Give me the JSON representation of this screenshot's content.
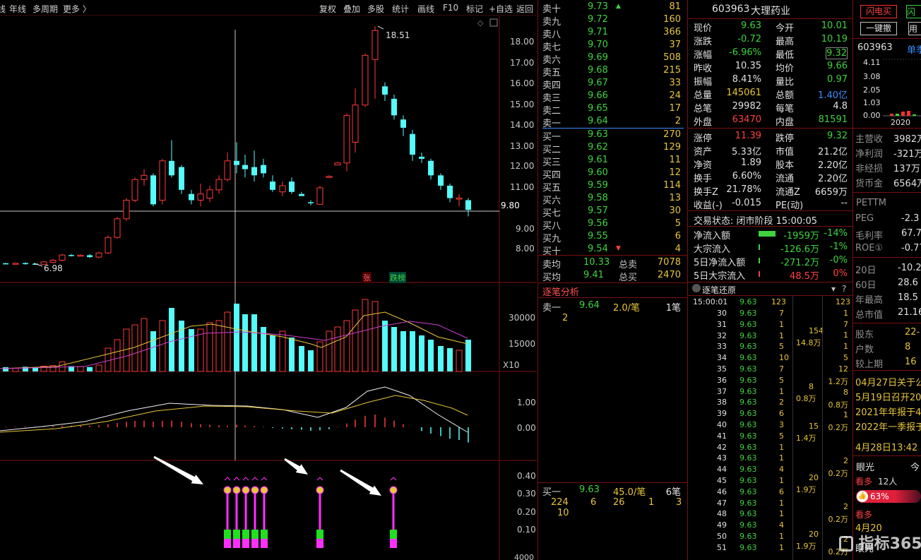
{
  "toolbar": {
    "left": [
      "年线",
      "多周期",
      "更多 〉"
    ],
    "right": [
      "复权",
      "叠加",
      "多股",
      "统计",
      "画线",
      "F10",
      "标记",
      "+自选",
      "返回"
    ]
  },
  "chart": {
    "price_ticks": [
      "18.00",
      "17.00",
      "16.00",
      "15.00",
      "14.00",
      "13.00",
      "12.00",
      "11.00",
      "9.80",
      "9.00",
      "8.00"
    ],
    "high_label": "18.51",
    "low_label": "6.98",
    "tag_zhang": "张",
    "tag_dieban": "跌榜",
    "vol_ticks": [
      "30000",
      "15000"
    ],
    "vol_unit": "X10",
    "macd_ticks": [
      "1.00",
      "0.00"
    ],
    "ind_ticks": [
      "0.40",
      "0.30",
      "0.20",
      "0.10"
    ],
    "bottom_tick": "4000"
  },
  "orderbook": {
    "sells": [
      {
        "label": "卖十",
        "price": "9.73",
        "vol": "81"
      },
      {
        "label": "卖九",
        "price": "9.72",
        "vol": "160"
      },
      {
        "label": "卖八",
        "price": "9.71",
        "vol": "366"
      },
      {
        "label": "卖七",
        "price": "9.70",
        "vol": "37"
      },
      {
        "label": "卖六",
        "price": "9.69",
        "vol": "508"
      },
      {
        "label": "卖五",
        "price": "9.68",
        "vol": "215"
      },
      {
        "label": "卖四",
        "price": "9.67",
        "vol": "33"
      },
      {
        "label": "卖三",
        "price": "9.66",
        "vol": "24"
      },
      {
        "label": "卖二",
        "price": "9.65",
        "vol": "17"
      },
      {
        "label": "卖一",
        "price": "9.64",
        "vol": "2"
      }
    ],
    "buys": [
      {
        "label": "买一",
        "price": "9.63",
        "vol": "270"
      },
      {
        "label": "买二",
        "price": "9.62",
        "vol": "129"
      },
      {
        "label": "买三",
        "price": "9.61",
        "vol": "11"
      },
      {
        "label": "买四",
        "price": "9.60",
        "vol": "12"
      },
      {
        "label": "买五",
        "price": "9.59",
        "vol": "114"
      },
      {
        "label": "买六",
        "price": "9.58",
        "vol": "13"
      },
      {
        "label": "买七",
        "price": "9.57",
        "vol": "30"
      },
      {
        "label": "买八",
        "price": "9.56",
        "vol": "5"
      },
      {
        "label": "买九",
        "price": "9.55",
        "vol": "6"
      },
      {
        "label": "买十",
        "price": "9.54",
        "vol": "4"
      }
    ],
    "avg_sell_label": "卖均",
    "avg_sell": "10.33",
    "total_sell_label": "总卖",
    "total_sell": "7078",
    "avg_buy_label": "买均",
    "avg_buy": "9.41",
    "total_buy_label": "总买",
    "total_buy": "2470"
  },
  "tick_analysis": {
    "title": "逐笔分析",
    "sell1": {
      "label": "卖一",
      "price": "9.64",
      "per": "2.0/笔",
      "count": "1笔",
      "list": "2"
    },
    "buy1": {
      "label": "买一",
      "price": "9.63",
      "per": "45.0/笔",
      "count": "6笔",
      "list": [
        "224",
        "6",
        "26",
        "1",
        "3",
        "10"
      ]
    }
  },
  "stock": {
    "code": "603963",
    "name": "大理药业",
    "rows": [
      {
        "l1": "现价",
        "v1": "9.63",
        "c1": "green",
        "l2": "今开",
        "v2": "10.01",
        "c2": "green"
      },
      {
        "l1": "涨跌",
        "v1": "-0.72",
        "c1": "green",
        "l2": "最高",
        "v2": "10.19",
        "c2": "green"
      },
      {
        "l1": "涨幅",
        "v1": "-6.96%",
        "c1": "green",
        "l2": "最低",
        "v2": "9.32",
        "c2": "green"
      },
      {
        "l1": "昨收",
        "v1": "10.35",
        "c1": "white",
        "l2": "均价",
        "v2": "9.66",
        "c2": "green"
      },
      {
        "l1": "振幅",
        "v1": "8.41%",
        "c1": "white",
        "l2": "量比",
        "v2": "0.97",
        "c2": "green"
      },
      {
        "l1": "总量",
        "v1": "145061",
        "c1": "yellow",
        "l2": "总额",
        "v2": "1.40亿",
        "c2": "blue"
      },
      {
        "l1": "总笔",
        "v1": "29982",
        "c1": "white",
        "l2": "每笔",
        "v2": "4.8",
        "c2": "white"
      },
      {
        "l1": "外盘",
        "v1": "63470",
        "c1": "red",
        "l2": "内盘",
        "v2": "81591",
        "c2": "green"
      },
      {
        "l1": "涨停",
        "v1": "11.39",
        "c1": "red",
        "l2": "跌停",
        "v2": "9.32",
        "c2": "green"
      },
      {
        "l1": "资产",
        "v1": "5.33亿",
        "c1": "white",
        "l2": "市值",
        "v2": "21.2亿",
        "c2": "white"
      },
      {
        "l1": "净资",
        "v1": "1.89",
        "c1": "white",
        "l2": "股本",
        "v2": "2.20亿",
        "c2": "white"
      },
      {
        "l1": "换手",
        "v1": "6.60%",
        "c1": "white",
        "l2": "流通",
        "v2": "2.20亿",
        "c2": "white"
      },
      {
        "l1": "换手Z",
        "v1": "21.78%",
        "c1": "white",
        "l2": "流通Z",
        "v2": "6659万",
        "c2": "white"
      },
      {
        "l1": "收益(-)",
        "v1": "-0.015",
        "c1": "white",
        "l2": "PE(动)",
        "v2": "--",
        "c2": "white"
      }
    ],
    "trade_status": "交易状态: 闭市阶段 15:00:05",
    "flows": [
      {
        "label": "净流入额",
        "value": "-1959万",
        "pct": "-14%",
        "color": "green",
        "bar": 0.25
      },
      {
        "label": "大宗流入",
        "value": "-126.6万",
        "pct": "-1%",
        "color": "green",
        "bar": 0.02
      },
      {
        "label": "5日净流入额",
        "value": "-271.2万",
        "pct": "-0%",
        "color": "green",
        "bar": 0.02
      },
      {
        "label": "5日大宗流入",
        "value": "48.5万",
        "pct": "0%",
        "color": "red",
        "bar": 0.02
      }
    ],
    "tick_title": "逐笔还原",
    "ticks_first": {
      "time": "15:00:01",
      "price": "9.63",
      "vol": "123",
      "right": "123"
    },
    "ticks": [
      {
        "m": "30",
        "v": "7"
      },
      {
        "m": "31",
        "v": "1"
      },
      {
        "m": "32",
        "v": "1"
      },
      {
        "m": "33",
        "v": "5"
      },
      {
        "m": "34",
        "v": "10"
      },
      {
        "m": "35",
        "v": "7"
      },
      {
        "m": "36",
        "v": "5"
      },
      {
        "m": "37",
        "v": "1"
      },
      {
        "m": "38",
        "v": "2"
      },
      {
        "m": "39",
        "v": "6"
      },
      {
        "m": "40",
        "v": "3"
      },
      {
        "m": "41",
        "v": "5"
      },
      {
        "m": "42",
        "v": "1"
      },
      {
        "m": "43",
        "v": "1"
      },
      {
        "m": "44",
        "v": "4"
      },
      {
        "m": "45",
        "v": "1"
      },
      {
        "m": "46",
        "v": "6"
      },
      {
        "m": "47",
        "v": "1"
      },
      {
        "m": "48",
        "v": "1"
      },
      {
        "m": "49",
        "v": "4"
      },
      {
        "m": "50",
        "v": "1"
      },
      {
        "m": "51",
        "v": "1"
      }
    ],
    "tick_price": "9.63",
    "agg": [
      {
        "a": "154",
        "b": "14.8万"
      },
      {
        "a": "8",
        "b": "0.8万"
      },
      {
        "a": "15",
        "b": "1.4万"
      },
      {
        "a": "20",
        "b": "1.9万"
      },
      {
        "a": "20",
        "b": "1.9万"
      }
    ],
    "right_col": [
      "1",
      "7",
      "1",
      "1",
      "5",
      "12",
      "1.2万",
      "8",
      "0.8万",
      "1",
      "0.2万",
      "2",
      "0.2万",
      "2",
      "0.2万",
      "2",
      "0.2万"
    ]
  },
  "far_right": {
    "btn_flash": "闪电买",
    "btn_one": "一键撤",
    "code": "603963",
    "tab": "单季",
    "mini_ticks": [
      "4.11",
      "3.08",
      "2.05",
      "1.03",
      "0.00"
    ],
    "mini_year": "2020",
    "fin": [
      {
        "l": "主营收",
        "v": "3982万"
      },
      {
        "l": "净利润",
        "v": "-321万"
      },
      {
        "l": "非经损",
        "v": "137万"
      },
      {
        "l": "货币金",
        "v": "6564万"
      }
    ],
    "pettm": "PETTM",
    "ratios": [
      {
        "l": "PEG",
        "v": "-2.3"
      },
      {
        "l": "毛利率",
        "v": "67.7"
      },
      {
        "l": "ROE①",
        "v": "-0.77"
      }
    ],
    "periods": [
      {
        "l": "20日",
        "v": "-10.2"
      },
      {
        "l": "60日",
        "v": "28.6"
      },
      {
        "l": "年最高",
        "v": "18.5"
      },
      {
        "l": "总市值",
        "v": "21.16"
      }
    ],
    "holders": [
      {
        "l": "股东",
        "v": "22-"
      },
      {
        "l": "户数",
        "v": "8"
      },
      {
        "l": "较上期",
        "v": "16"
      }
    ],
    "news": [
      "04月27日关于公",
      "5月19日召开20",
      "2021年年报于4",
      "2022年一季报于"
    ],
    "news_time": "4月28日13:42",
    "eye": "眼光",
    "eye_r": "今",
    "bull": "看多",
    "bull_count": "12人",
    "pct": "63%",
    "bull2": "看多",
    "date2": "4月20",
    "eye2": "眼光",
    "watermark": "指标365"
  }
}
